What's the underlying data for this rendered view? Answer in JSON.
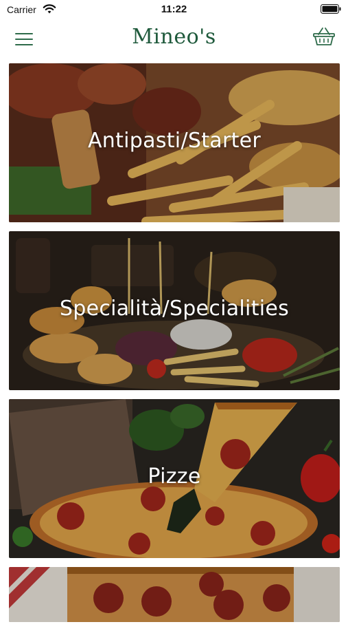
{
  "status_bar": {
    "carrier": "Carrier",
    "time": "11:22"
  },
  "nav": {
    "title": "Mineo's"
  },
  "categories": [
    {
      "label": "Antipasti/Starter"
    },
    {
      "label": "Specialità/Specialities"
    },
    {
      "label": "Pizze"
    },
    {
      "label": ""
    }
  ],
  "colors": {
    "brand_green": "#1f5a3c",
    "background": "#ffffff"
  },
  "icons": {
    "menu": "hamburger-menu-icon",
    "cart": "basket-icon",
    "wifi": "wifi-icon",
    "battery": "battery-icon"
  }
}
